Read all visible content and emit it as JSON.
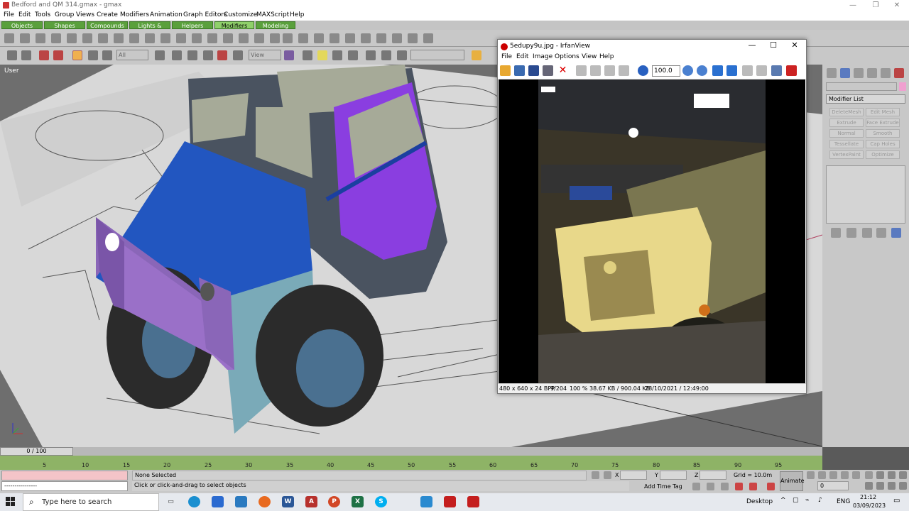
{
  "app": {
    "title": "Bedford and QM 314.gmax - gmax"
  },
  "menu": [
    "File",
    "Edit",
    "Tools",
    "Group",
    "Views",
    "Create",
    "Modifiers",
    "Animation",
    "Graph Editors",
    "Customize",
    "MAXScript",
    "Help"
  ],
  "tabs": [
    {
      "label": "Objects"
    },
    {
      "label": "Shapes"
    },
    {
      "label": "Compounds"
    },
    {
      "label": "Lights & Cameras"
    },
    {
      "label": "Helpers"
    },
    {
      "label": "Modifiers"
    },
    {
      "label": "Modeling"
    }
  ],
  "toolbar": {
    "selection_filter": "All",
    "coord_system": "View"
  },
  "viewport": {
    "label": "User"
  },
  "command_panel": {
    "modifier_list": "Modifier List",
    "buttons": [
      "DeleteMesh",
      "Edit Mesh",
      "Extrude",
      "Face Extrude",
      "Normal",
      "Smooth",
      "Tessellate",
      "Cap Holes",
      "VertexPaint",
      "Optimize"
    ]
  },
  "timeline": {
    "slider": "0 / 100",
    "ticks": [
      "5",
      "10",
      "15",
      "20",
      "25",
      "30",
      "35",
      "40",
      "45",
      "50",
      "55",
      "60",
      "65",
      "70",
      "75",
      "80",
      "85",
      "90",
      "95"
    ]
  },
  "status": {
    "selected": "None Selected",
    "prompt": "Click or click-and-drag to select objects",
    "add_time_tag": "Add Time Tag",
    "grid": "Grid = 10.0m",
    "animate": "Animate",
    "frame": "0",
    "x_label": "X",
    "y_label": "Y",
    "z_label": "Z",
    "script_line": "----------------"
  },
  "irfanview": {
    "title": "5edupy9u.jpg - IrfanView",
    "menu": [
      "File",
      "Edit",
      "Image",
      "Options",
      "View",
      "Help"
    ],
    "zoom": "100.0",
    "status": {
      "dims": "480 x 640 x 24 BPP",
      "index": "9/204",
      "zoom": "100 %",
      "size": "38.67 KB / 900.04 KB",
      "date": "28/10/2021 / 12:49:00"
    }
  },
  "taskbar": {
    "search_placeholder": "Type here to search",
    "desktop": "Desktop",
    "lang": "ENG",
    "time": "21:12",
    "date": "03/09/2023"
  },
  "colors": {
    "tab_green": "#5aa03c",
    "timeline_green": "#8eb366",
    "hood_blue": "#2255b8",
    "door_purple": "#7b3fd0"
  }
}
